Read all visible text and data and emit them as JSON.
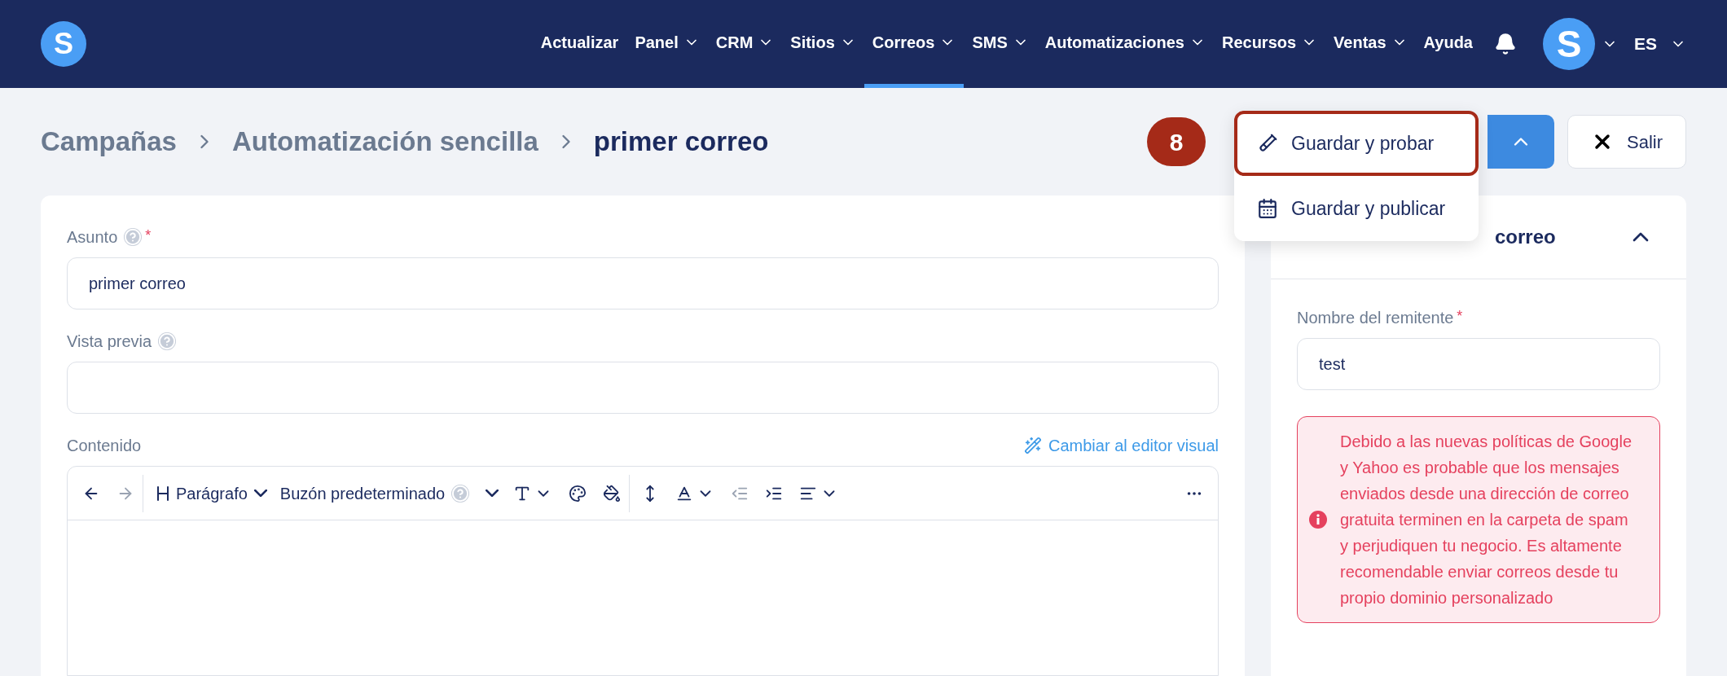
{
  "navbar": {
    "logo": "S",
    "items": [
      {
        "label": "Actualizar",
        "dropdown": false,
        "selected": false
      },
      {
        "label": "Panel",
        "dropdown": true,
        "selected": false
      },
      {
        "label": "CRM",
        "dropdown": true,
        "selected": false
      },
      {
        "label": "Sitios",
        "dropdown": true,
        "selected": false
      },
      {
        "label": "Correos",
        "dropdown": true,
        "selected": true
      },
      {
        "label": "SMS",
        "dropdown": true,
        "selected": false
      },
      {
        "label": "Automatizaciones",
        "dropdown": true,
        "selected": false
      },
      {
        "label": "Recursos",
        "dropdown": true,
        "selected": false
      },
      {
        "label": "Ventas",
        "dropdown": true,
        "selected": false
      },
      {
        "label": "Ayuda",
        "dropdown": false,
        "selected": false
      }
    ],
    "avatar": "S",
    "language": "ES"
  },
  "breadcrumb": [
    "Campañas",
    "Automatización sencilla",
    "primer correo"
  ],
  "step_badge": "8",
  "save_menu": [
    {
      "kind": "test",
      "label": "Guardar y probar",
      "highlighted": true
    },
    {
      "kind": "publish",
      "label": "Guardar y publicar",
      "highlighted": false
    }
  ],
  "exit_button": "Salir",
  "form": {
    "subject": {
      "label": "Asunto",
      "required_mark": "*",
      "value": "primer correo"
    },
    "preview": {
      "label": "Vista previa"
    },
    "content": {
      "label": "Contenido",
      "switch_link": "Cambiar al editor visual",
      "toolbar": [
        [
          {
            "kind": "undo",
            "disabled": false
          },
          {
            "kind": "redo",
            "disabled": true
          }
        ],
        [
          {
            "kind": "block-format",
            "label": "Parágrafo"
          },
          {
            "kind": "mailbox",
            "label": "Buzón predeterminado"
          },
          {
            "kind": "font-size"
          },
          {
            "kind": "text-color"
          },
          {
            "kind": "highlight"
          }
        ],
        [
          {
            "kind": "line-height"
          },
          {
            "kind": "underline-style"
          },
          {
            "kind": "outdent",
            "disabled": true
          },
          {
            "kind": "indent",
            "disabled": false
          },
          {
            "kind": "align"
          }
        ],
        [
          {
            "kind": "more"
          }
        ]
      ]
    }
  },
  "settings_panel": {
    "title": "correo",
    "expanded": true,
    "sender": {
      "label": "Nombre del remitente",
      "required_mark": "*",
      "value": "test"
    },
    "alert": "Debido a las nuevas políticas de Google y Yahoo es probable que los mensajes enviados desde una dirección de correo gratuita terminen en la carpeta de spam y perjudiquen tu negocio. Es altamente recomendable enviar correos desde tu propio dominio personalizado"
  }
}
